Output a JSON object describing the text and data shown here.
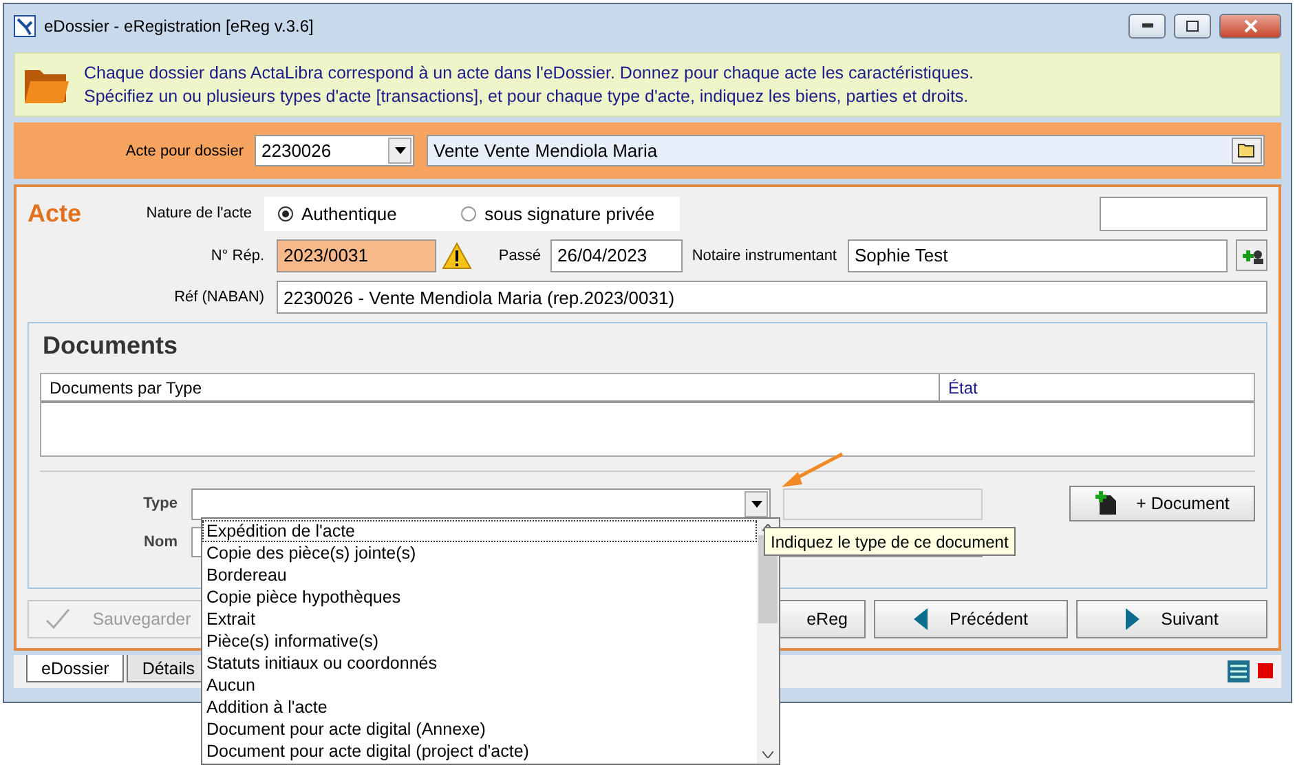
{
  "window": {
    "title": "eDossier - eRegistration [eReg v.3.6]"
  },
  "info": {
    "lines": [
      "Chaque dossier dans ActaLibra correspond à un acte dans l'eDossier.  Donnez pour chaque acte les caractéristiques.",
      "Spécifiez un ou plusieurs types d'acte [transactions], et pour chaque type d'acte, indiquez les biens, parties et droits."
    ]
  },
  "dossier": {
    "label": "Acte pour dossier",
    "number": "2230026",
    "name": "Vente Vente Mendiola Maria"
  },
  "acte": {
    "title": "Acte",
    "nature_label": "Nature de l'acte",
    "nature_options": [
      {
        "label": "Authentique",
        "selected": true
      },
      {
        "label": "sous signature privée",
        "selected": false
      }
    ],
    "rep_label": "N° Rép.",
    "rep": "2023/0031",
    "rep_warning": true,
    "passe_label": "Passé",
    "passe": "26/04/2023",
    "notaire_label": "Notaire instrumentant",
    "notaire": "Sophie Test",
    "ref_label": "Réf (NABAN)",
    "ref": "2230026 - Vente Mendiola Maria (rep.2023/0031)"
  },
  "documents": {
    "title": "Documents",
    "columns": [
      "Documents par Type",
      "État"
    ],
    "type_label": "Type",
    "nom_label": "Nom",
    "add_button": "+ Document",
    "tooltip": "Indiquez le type de ce document",
    "type_options": [
      {
        "label": "Expédition de l'acte",
        "selected": true
      },
      {
        "label": "Copie des pièce(s) jointe(s)",
        "selected": false
      },
      {
        "label": "Bordereau",
        "selected": false
      },
      {
        "label": "Copie pièce hypothèques",
        "selected": false
      },
      {
        "label": "Extrait",
        "selected": false
      },
      {
        "label": "Pièce(s) informative(s)",
        "selected": false
      },
      {
        "label": "Statuts initiaux ou coordonnés",
        "selected": false
      },
      {
        "label": "Aucun",
        "selected": false
      },
      {
        "label": "Addition à l'acte",
        "selected": false
      },
      {
        "label": "Document pour acte digital (Annexe)",
        "selected": false
      },
      {
        "label": "Document pour acte digital (project d'acte)",
        "selected": false
      }
    ]
  },
  "buttons": [
    {
      "label": "Sauvegarder",
      "kind": "save",
      "disabled": true
    },
    {
      "label": "eReg",
      "kind": "plain",
      "disabled": false
    },
    {
      "label": "Précédent",
      "kind": "prev",
      "disabled": false
    },
    {
      "label": "Suivant",
      "kind": "next",
      "disabled": false
    }
  ],
  "tabs": [
    {
      "label": "eDossier",
      "selected": true
    },
    {
      "label": "Détails",
      "selected": false
    }
  ]
}
